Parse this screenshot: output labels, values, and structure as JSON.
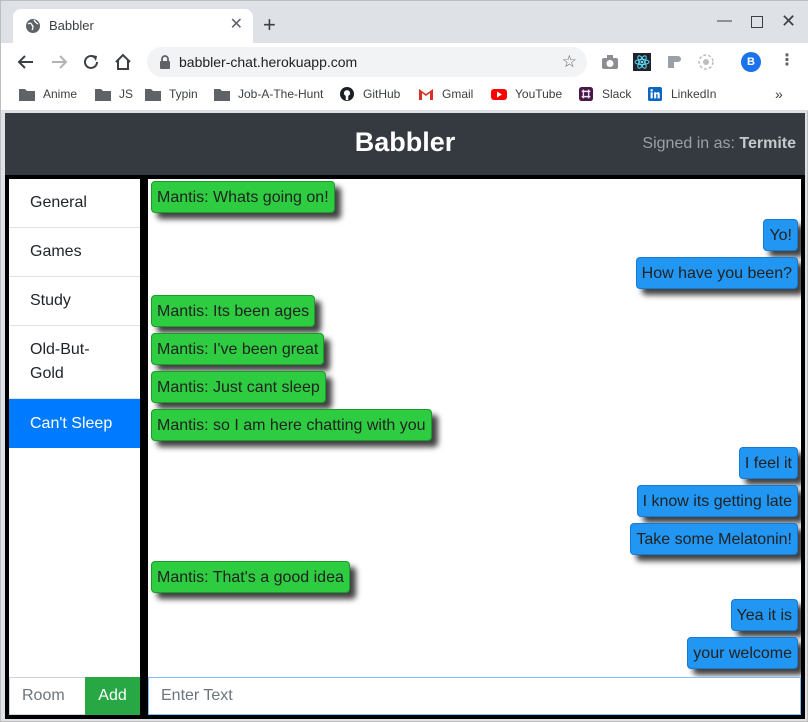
{
  "browser": {
    "tab_title": "Babbler",
    "url": "babbler-chat.herokuapp.com",
    "profile_initial": "B",
    "bookmarks": [
      {
        "label": "Anime",
        "icon": "folder-icon"
      },
      {
        "label": "JS",
        "icon": "folder-icon"
      },
      {
        "label": "Typin",
        "icon": "folder-icon"
      },
      {
        "label": "Job-A-The-Hunt",
        "icon": "folder-icon"
      },
      {
        "label": "GitHub",
        "icon": "github-icon"
      },
      {
        "label": "Gmail",
        "icon": "gmail-icon"
      },
      {
        "label": "YouTube",
        "icon": "youtube-icon"
      },
      {
        "label": "Slack",
        "icon": "slack-icon"
      },
      {
        "label": "LinkedIn",
        "icon": "linkedin-icon"
      }
    ]
  },
  "app": {
    "title": "Babbler",
    "signed_in_label": "Signed in as:",
    "username": "Termite",
    "rooms": [
      "General",
      "Games",
      "Study",
      "Old-But-Gold",
      "Can't Sleep"
    ],
    "active_room": "Can't Sleep",
    "room_placeholder": "Room",
    "add_label": "Add",
    "text_placeholder": "Enter Text",
    "messages": [
      {
        "sender": "other",
        "text": "Mantis: Whats going on!"
      },
      {
        "sender": "self",
        "text": "Yo!"
      },
      {
        "sender": "self",
        "text": "How have you been?"
      },
      {
        "sender": "other",
        "text": "Mantis: Its been ages"
      },
      {
        "sender": "other",
        "text": "Mantis: I've been great"
      },
      {
        "sender": "other",
        "text": "Mantis: Just cant sleep"
      },
      {
        "sender": "other",
        "text": "Mantis: so I am here chatting with you"
      },
      {
        "sender": "self",
        "text": "I feel it"
      },
      {
        "sender": "self",
        "text": "I know its getting late"
      },
      {
        "sender": "self",
        "text": "Take some Melatonin!"
      },
      {
        "sender": "other",
        "text": "Mantis: That's a good idea"
      },
      {
        "sender": "self",
        "text": "Yea it is"
      },
      {
        "sender": "self",
        "text": "your welcome"
      }
    ]
  },
  "colors": {
    "header_bg": "#343a40",
    "active_room": "#007bff",
    "add_button": "#28a745",
    "other_bubble": "#2ecc40",
    "self_bubble": "#2196f3"
  }
}
